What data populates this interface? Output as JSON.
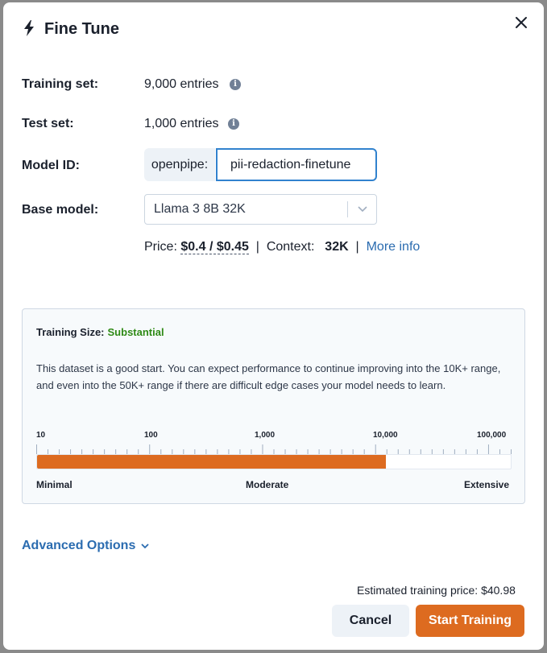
{
  "dialog": {
    "title": "Fine Tune",
    "icon": "lightning-bolt-icon",
    "close_icon": "close-icon"
  },
  "fields": {
    "training_set": {
      "label": "Training set:",
      "value": "9,000 entries"
    },
    "test_set": {
      "label": "Test set:",
      "value": "1,000 entries"
    },
    "model_id": {
      "label": "Model ID:",
      "prefix": "openpipe:",
      "value": "pii-redaction-finetune"
    },
    "base_model": {
      "label": "Base model:",
      "selected": "Llama 3 8B 32K"
    }
  },
  "pricing": {
    "price_label": "Price:",
    "price_value": "$0.4 / $0.45",
    "separator": "|",
    "context_label": "Context:",
    "context_value": "32K",
    "more_info": "More info"
  },
  "training_size": {
    "title": "Training Size:",
    "level": "Substantial",
    "level_color": "#2f8a16",
    "description": "This dataset is a good start. You can expect performance to continue improving into the 10K+ range, and even into the 50K+ range if there are difficult edge cases your model needs to learn.",
    "ticks": [
      "10",
      "100",
      "1,000",
      "10,000",
      "100,000"
    ],
    "fill_fraction": 0.737,
    "fill_color": "#dd6b20",
    "scale_labels": {
      "min": "Minimal",
      "mid": "Moderate",
      "max": "Extensive"
    }
  },
  "advanced_options": "Advanced Options",
  "footer": {
    "estimated_price": "Estimated training price: $40.98",
    "cancel": "Cancel",
    "start": "Start Training"
  }
}
